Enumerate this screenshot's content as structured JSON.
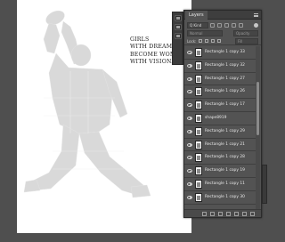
{
  "document": {
    "headline_lines": [
      "GIRLS",
      "WITH DREAMS",
      "BECOME WOMEN",
      "WITH VISION."
    ]
  },
  "layers_panel": {
    "tab_label": "Layers",
    "filter_kind": "Q Kind",
    "blend_mode": "Normal",
    "opacity_label": "Opacity",
    "lock_label": "Lock:",
    "fill_label": "Fill",
    "layers": [
      {
        "name": "Rectangle 1 copy 33",
        "thumb": "shape"
      },
      {
        "name": "Rectangle 1 copy 32",
        "thumb": "shape"
      },
      {
        "name": "Rectangle 1 copy 27",
        "thumb": "shape"
      },
      {
        "name": "Rectangle 1 copy 26",
        "thumb": "shape"
      },
      {
        "name": "Rectangle 1 copy 17",
        "thumb": "shape"
      },
      {
        "name": "shape8919",
        "thumb": "photo"
      },
      {
        "name": "Rectangle 1 copy 29",
        "thumb": "shape"
      },
      {
        "name": "Rectangle 1 copy 21",
        "thumb": "shape"
      },
      {
        "name": "Rectangle 1 copy 28",
        "thumb": "shape"
      },
      {
        "name": "Rectangle 1 copy 19",
        "thumb": "shape"
      },
      {
        "name": "Rectangle 1 copy 11",
        "thumb": "shape"
      },
      {
        "name": "Rectangle 1 copy 30",
        "thumb": "shape"
      }
    ]
  },
  "colors": {
    "workspace_bg": "#4f4f4f",
    "panel_bg": "#535353",
    "silhouette": "#d9d9d9"
  }
}
